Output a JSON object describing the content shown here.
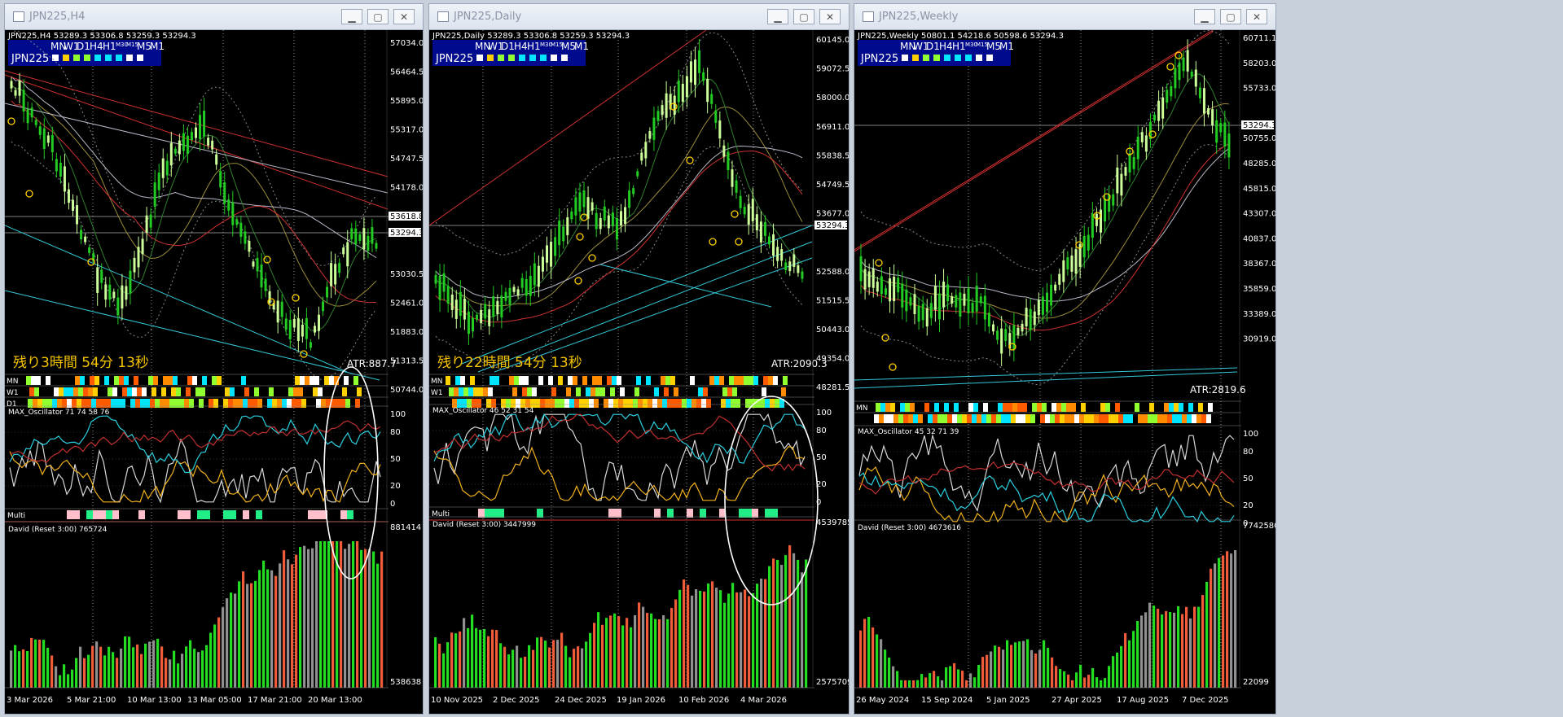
{
  "windows": [
    {
      "id": "h4",
      "title": "JPN225,H4",
      "ohlc": "JPN225,H4  53289.3 53306.8 53259.3 53294.3",
      "legend": {
        "symbol": "JPN225",
        "tfs": "MN W1 D1 H4 H1 M30 M15 M5 M1",
        "tfs_short": [
          "MN",
          "W1",
          "D1",
          "H4",
          "H1",
          "M30",
          "M15",
          "M5",
          "M1"
        ]
      },
      "price_labels": [
        "57034.0",
        "56464.5",
        "55895.0",
        "55317.0",
        "54747.5",
        "54178.0",
        "53618.8",
        "53294.3",
        "53030.5",
        "52461.0",
        "51883.0",
        "51313.5",
        "50744.0"
      ],
      "timer": "残り3時間 54分 13秒",
      "atr": "ATR:887.7",
      "bar_rows": [
        "MN",
        "W1",
        "D1"
      ],
      "osc_label": "MAX_Oscillator 71 74 58 76",
      "osc_levels": [
        "100",
        "80",
        "50",
        "20",
        "0"
      ],
      "multi_label": "Multi",
      "david_label": "David (Reset 3:00) 765724",
      "david_levels": [
        "881414",
        "538638"
      ],
      "dates": [
        "3 Mar 2026",
        "5 Mar 21:00",
        "10 Mar 13:00",
        "13 Mar 05:00",
        "17 Mar 21:00",
        "20 Mar 13:00"
      ],
      "current_price": "53294.3",
      "marked_price": "53618.8"
    },
    {
      "id": "daily",
      "title": "JPN225,Daily",
      "ohlc": "JPN225,Daily  53289.3 53306.8 53259.3 53294.3",
      "legend": {
        "symbol": "JPN225",
        "tfs": "MN W1 D1 H4 H1 M30 M15 M5 M1"
      },
      "price_labels": [
        "60145.0",
        "59072.5",
        "58000.0",
        "56911.0",
        "55838.5",
        "54749.5",
        "53677.0",
        "53294.3",
        "52588.0",
        "51515.5",
        "50443.0",
        "49354.0",
        "48281.5"
      ],
      "timer": "残り22時間 54分 13秒",
      "atr": "ATR:2090.3",
      "bar_rows": [
        "MN",
        "W1",
        ""
      ],
      "osc_label": "MAX_Oscillator 46 52 31 54",
      "osc_levels": [
        "100",
        "80",
        "50",
        "20",
        "0"
      ],
      "multi_label": "Multi",
      "david_label": "David (Reset 3:00) 3447999",
      "david_levels": [
        "4539785",
        "2575709"
      ],
      "dates": [
        "10 Nov 2025",
        "2 Dec 2025",
        "24 Dec 2025",
        "19 Jan 2026",
        "10 Feb 2026",
        "4 Mar 2026"
      ],
      "current_price": "53294.3"
    },
    {
      "id": "weekly",
      "title": "JPN225,Weekly",
      "ohlc": "JPN225,Weekly  50801.1 54218.6 50598.6 53294.3",
      "legend": {
        "symbol": "JPN225",
        "tfs": "MN W1 D1 H4 H1 M30 M15 M5 M1"
      },
      "price_labels": [
        "60711.1",
        "58203.0",
        "55733.0",
        "53294.3",
        "50755.0",
        "48285.0",
        "45815.0",
        "43307.0",
        "40837.0",
        "38367.0",
        "35859.0",
        "33389.0",
        "30919.0"
      ],
      "atr": "ATR:2819.6",
      "bar_rows": [
        "MN",
        ""
      ],
      "osc_label": "MAX_Oscillator 45 32 71 39",
      "osc_levels": [
        "100",
        "80",
        "50",
        "20",
        "0"
      ],
      "david_label": "David (Reset 3:00) 4673616",
      "david_levels": [
        "7742580",
        "22099"
      ],
      "dates": [
        "26 May 2024",
        "15 Sep 2024",
        "5 Jan 2025",
        "27 Apr 2025",
        "17 Aug 2025",
        "7 Dec 2025"
      ],
      "current_price": "53294.3"
    }
  ],
  "colors": {
    "candle": "#22cc22",
    "candle_up": "#ccff99",
    "ma_red": "#d03030",
    "trend_cyan": "#33c8d8",
    "timer": "#f5c400",
    "osc_yellow": "#f2b21e",
    "osc_cyan": "#2ad0e0",
    "david_green": "#22dd22",
    "david_red": "#f05b3a",
    "david_gray": "#909090",
    "legend_bg": "#000a8c"
  }
}
